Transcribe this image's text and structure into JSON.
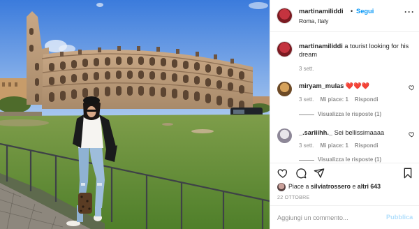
{
  "post": {
    "photo_description": "photo"
  },
  "header": {
    "username": "martinamiliddi",
    "follow_label": "Segui",
    "location": "Roma, Italy",
    "separator": "•"
  },
  "caption": {
    "username": "martinamiliddi",
    "text": " a tourist looking for his dream",
    "time": "3 sett."
  },
  "comments": [
    {
      "username": "miryam_mulas",
      "text": " ❤️❤️❤️",
      "time": "3 sett.",
      "likes_label": "Mi piace: 1",
      "reply_label": "Rispondi",
      "view_replies_label": "Visualizza le risposte (1)"
    },
    {
      "username": "_.sariiihh._",
      "text": " Sei bellissimaaaa",
      "time": "3 sett.",
      "likes_label": "Mi piace: 1",
      "reply_label": "Rispondi",
      "view_replies_label": "Visualizza le risposte (1)"
    }
  ],
  "likes": {
    "prefix": "Piace a ",
    "first_user": "silviatrossero",
    "connector": " e ",
    "others": "altri 643"
  },
  "date": "22 OTTOBRE",
  "composer": {
    "placeholder": "Aggiungi un commento...",
    "publish_label": "Pubblica"
  },
  "colors": {
    "link_blue": "#0095f6",
    "muted": "#8e8e8e",
    "heart_red": "#ed4956",
    "publish_disabled": "#b2dffc"
  },
  "icons": {
    "heart": "heart-icon",
    "comment": "comment-icon",
    "share": "paper-plane-icon",
    "save": "bookmark-icon",
    "more": "more-options-icon"
  }
}
